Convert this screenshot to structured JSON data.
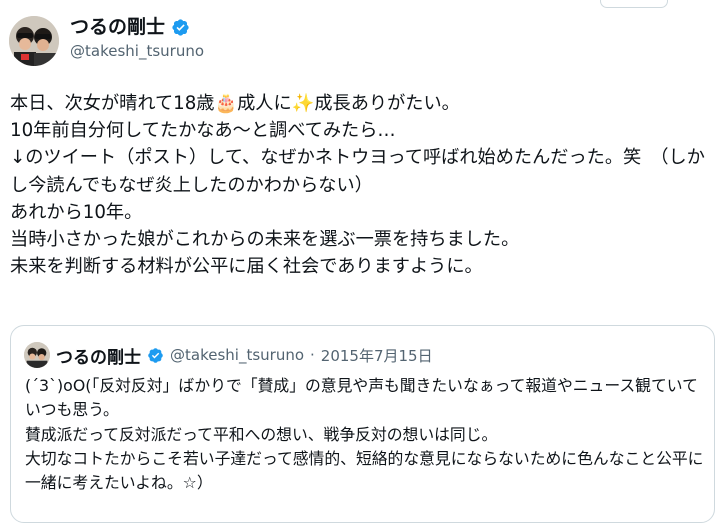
{
  "author": {
    "display_name": "つるの剛士",
    "handle": "@takeshi_tsuruno",
    "avatar_icon": "avatar-photo",
    "verified_icon": "verified-badge-icon",
    "verified_color": "#1d9bf0"
  },
  "tweet": {
    "lines": [
      "本日、次女が晴れて18歳🎂成人に✨成長ありがたい。",
      "10年前自分何してたかなあ〜と調べてみたら…",
      "↓のツイート（ポスト）して、なぜかネトウヨって呼ばれ始めたんだった。笑　（しかし今読んでもなぜ炎上したのかわからない）",
      "あれから10年。",
      "当時小さかった娘がこれからの未来を選ぶ一票を持ちました。",
      "未来を判断する材料が公平に届く社会でありますように。"
    ]
  },
  "quote": {
    "display_name": "つるの剛士",
    "handle": "@takeshi_tsuruno",
    "separator": "·",
    "date": "2015年7月15日",
    "lines": [
      "(´3`)oO(「反対反対」ばかりで「賛成」の意見や声も聞きたいなぁって報道やニュース観ていていつも思う。",
      "賛成派だって反対派だって平和への想い、戦争反対の想いは同じ。",
      "大切なコトたからこそ若い子達だって感情的、短絡的な意見にならないために色んなこと公平に一緒に考えたいよね。☆）"
    ]
  }
}
